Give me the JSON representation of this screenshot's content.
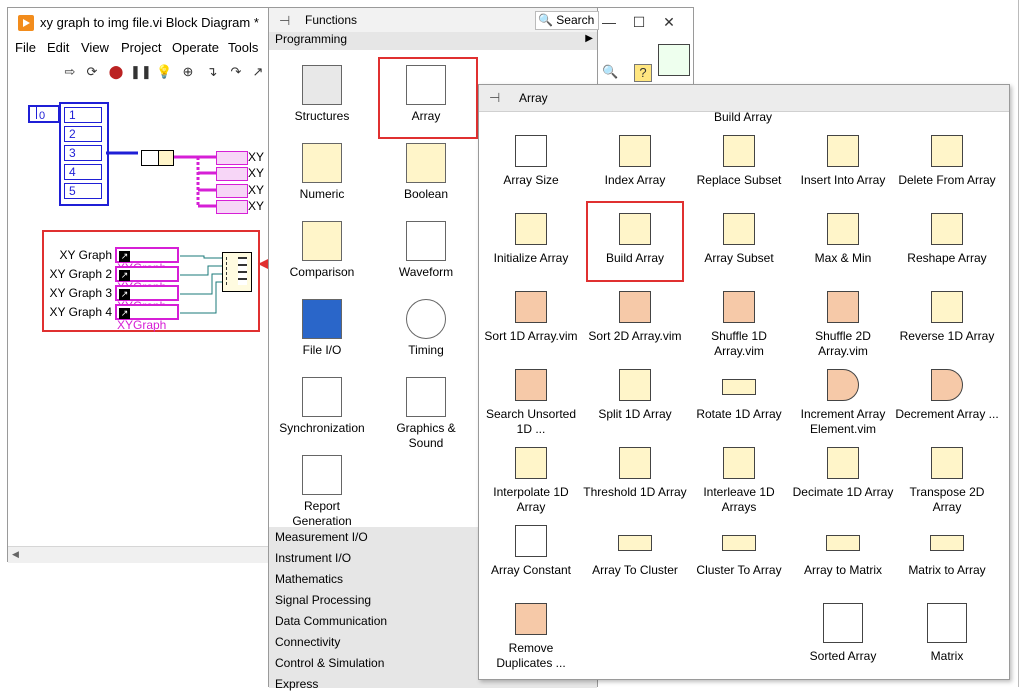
{
  "block_diagram": {
    "title": "xy graph to img file.vi Block Diagram *",
    "menu": [
      "File",
      "Edit",
      "View",
      "Project",
      "Operate",
      "Tools"
    ],
    "numeric_constant": "0",
    "array_values": [
      "1",
      "2",
      "3",
      "4",
      "5"
    ],
    "wire_labels": [
      "XY",
      "XY",
      "XY",
      "XY"
    ],
    "graph_rows": [
      {
        "label": "XY Graph",
        "ref": "XYGraph"
      },
      {
        "label": "XY Graph 2",
        "ref": "XYGraph"
      },
      {
        "label": "XY Graph 3",
        "ref": "XYGraph"
      },
      {
        "label": "XY Graph 4",
        "ref": "XYGraph"
      }
    ]
  },
  "functions_palette": {
    "title": "Functions",
    "search_label": "Search",
    "category": "Programming",
    "tiles": [
      {
        "label": "Structures",
        "icon": "structures-icon"
      },
      {
        "label": "Array",
        "icon": "array-icon"
      },
      {
        "label": "Numeric",
        "icon": "numeric-icon"
      },
      {
        "label": "Boolean",
        "icon": "boolean-icon"
      },
      {
        "label": "Comparison",
        "icon": "comparison-icon"
      },
      {
        "label": "Waveform",
        "icon": "waveform-icon"
      },
      {
        "label": "File I/O",
        "icon": "file-io-icon"
      },
      {
        "label": "Timing",
        "icon": "timing-icon"
      },
      {
        "label": "Synchronization",
        "icon": "synchronization-icon"
      },
      {
        "label": "Graphics & Sound",
        "icon": "graphics-sound-icon"
      },
      {
        "label": "Report Generation",
        "icon": "report-generation-icon"
      }
    ],
    "categories": [
      "Measurement I/O",
      "Instrument I/O",
      "Mathematics",
      "Signal Processing",
      "Data Communication",
      "Connectivity",
      "Control & Simulation",
      "Express"
    ]
  },
  "array_palette": {
    "title": "Array",
    "hover_label": "Build Array",
    "items": [
      "Array Size",
      "Index Array",
      "Replace Subset",
      "Insert Into Array",
      "Delete From Array",
      "Initialize Array",
      "Build Array",
      "Array Subset",
      "Max & Min",
      "Reshape Array",
      "Sort 1D Array.vim",
      "Sort 2D Array.vim",
      "Shuffle 1D Array.vim",
      "Shuffle 2D Array.vim",
      "Reverse 1D Array",
      "Search Unsorted 1D ...",
      "Split 1D Array",
      "Rotate 1D Array",
      "Increment Array Element.vim",
      "Decrement Array ...",
      "Interpolate 1D Array",
      "Threshold 1D Array",
      "Interleave 1D Arrays",
      "Decimate 1D Array",
      "Transpose 2D Array",
      "Array Constant",
      "Array To Cluster",
      "Cluster To Array",
      "Array to Matrix",
      "Matrix to Array",
      "Remove Duplicates ...",
      "Sorted Array",
      "Matrix"
    ]
  },
  "colors": {
    "highlight_box": "#e03030",
    "numeric_wire": "#1f1fd6",
    "refnum_wire": "#d61fd6",
    "palette_category_bg": "#e6e6e6"
  }
}
